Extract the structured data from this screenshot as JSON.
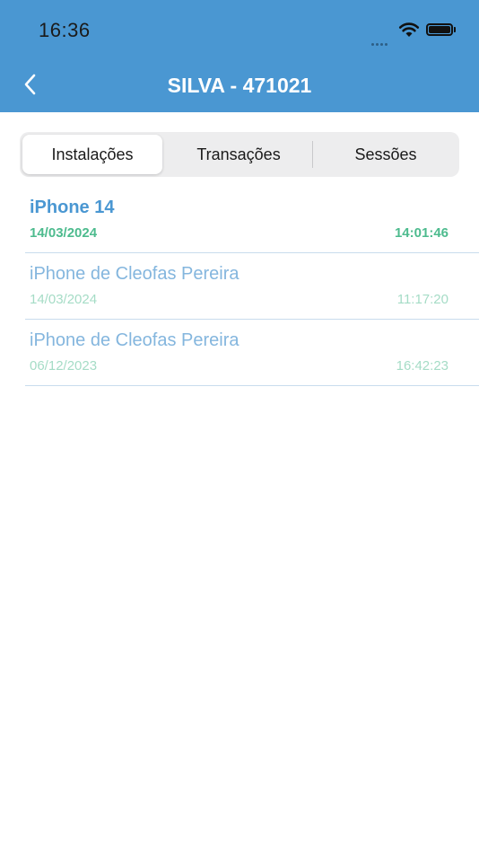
{
  "status_bar": {
    "time": "16:36"
  },
  "header": {
    "title": "SILVA - 471021"
  },
  "tabs": [
    {
      "label": "Instalações",
      "active": true
    },
    {
      "label": "Transações",
      "active": false
    },
    {
      "label": "Sessões",
      "active": false
    }
  ],
  "installations": [
    {
      "device": "iPhone 14",
      "date": "14/03/2024",
      "time": "14:01:46",
      "current": true
    },
    {
      "device": "iPhone de Cleofas Pereira",
      "date": "14/03/2024",
      "time": "11:17:20",
      "current": false
    },
    {
      "device": "iPhone de Cleofas Pereira",
      "date": "06/12/2023",
      "time": "16:42:23",
      "current": false
    }
  ],
  "colors": {
    "header_bg": "#4a97d2",
    "device_active": "#4a97d2",
    "datetime_active": "#4dbb8e",
    "device_inactive": "#84b6de",
    "datetime_inactive": "#a5dcc6"
  }
}
